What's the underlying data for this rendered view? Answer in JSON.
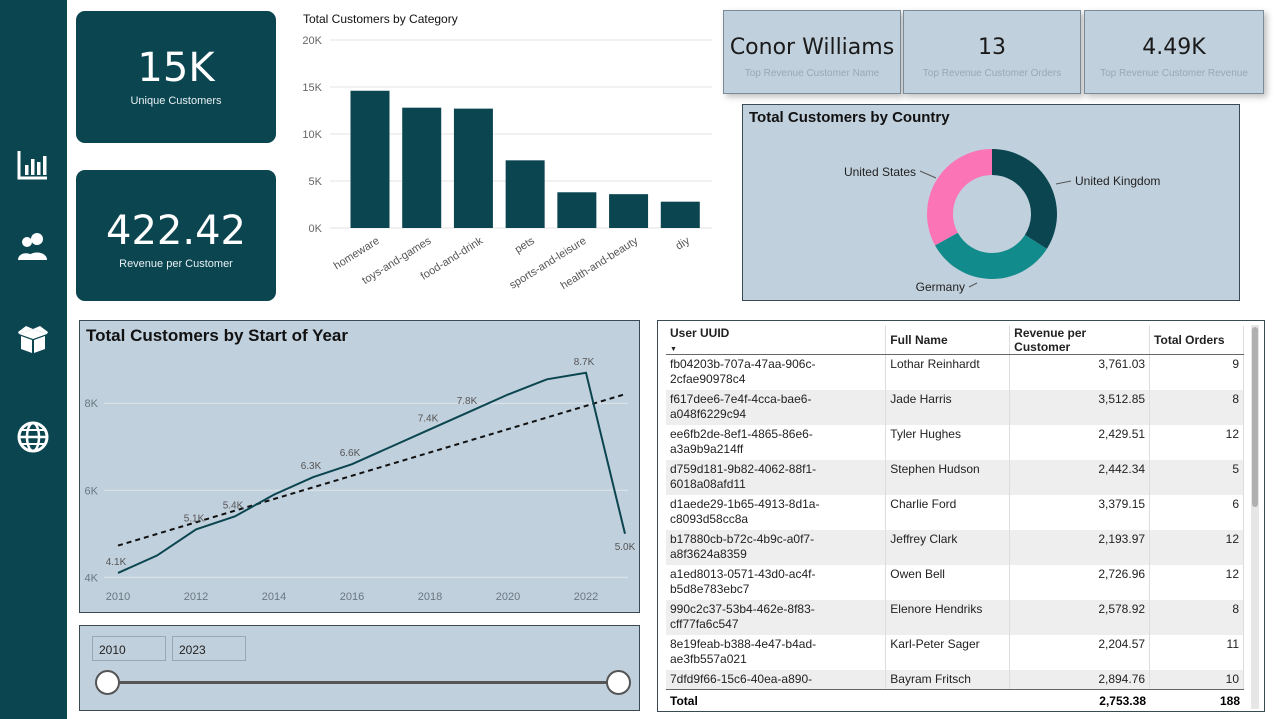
{
  "sidebar": {
    "icons": [
      "bar-chart-icon",
      "users-icon",
      "box-icon",
      "globe-icon"
    ]
  },
  "kpis": {
    "unique_customers": {
      "value": "15K",
      "label": "Unique Customers"
    },
    "revenue_per_customer": {
      "value": "422.42",
      "label": "Revenue per Customer"
    }
  },
  "top_cards": [
    {
      "value": "Conor Williams",
      "label": "Top Revenue Customer Name"
    },
    {
      "value": "13",
      "label": "Top Revenue Customer Orders"
    },
    {
      "value": "4.49K",
      "label": "Top Revenue Customer Revenue"
    }
  ],
  "colors": {
    "dark_teal": "#0a4550",
    "teal": "#118b8b",
    "pink": "#fb74b6",
    "panel": "#c1d0dd"
  },
  "chart_data": [
    {
      "type": "bar",
      "title": "Total Customers by Category",
      "categories": [
        "homeware",
        "toys-and-games",
        "food-and-drink",
        "pets",
        "sports-and-leisure",
        "health-and-beauty",
        "diy"
      ],
      "values": [
        14600,
        12800,
        12700,
        7200,
        3800,
        3600,
        2800
      ],
      "ylim": [
        0,
        20000
      ],
      "yticks": [
        "0K",
        "5K",
        "10K",
        "15K",
        "20K"
      ],
      "grid": true
    },
    {
      "type": "pie",
      "title": "Total Customers by Country",
      "labels": [
        "United Kingdom",
        "Germany",
        "United States"
      ],
      "values": [
        34,
        33,
        33
      ],
      "colors": [
        "#0a4550",
        "#118b8b",
        "#fb74b6"
      ]
    },
    {
      "type": "line",
      "title": "Total Customers by Start of Year",
      "x": [
        2010,
        2011,
        2012,
        2013,
        2014,
        2015,
        2016,
        2017,
        2018,
        2019,
        2020,
        2021,
        2022,
        2023
      ],
      "y": [
        4100,
        4500,
        5100,
        5400,
        5900,
        6300,
        6600,
        7000,
        7400,
        7800,
        8200,
        8550,
        8700,
        5000
      ],
      "data_labels": [
        "4.1K",
        "",
        "5.1K",
        "5.4K",
        "",
        "6.3K",
        "6.6K",
        "",
        "7.4K",
        "7.8K",
        "",
        "",
        "8.7K",
        "5.0K"
      ],
      "xticks": [
        "2010",
        "2012",
        "2014",
        "2016",
        "2018",
        "2020",
        "2022"
      ],
      "yticks": [
        "4K",
        "6K",
        "8K"
      ],
      "ylim": [
        3800,
        9200
      ],
      "trendline": true
    },
    {
      "type": "table",
      "columns": [
        "User UUID",
        "Full Name",
        "Revenue per Customer",
        "Total Orders"
      ],
      "rows": [
        [
          "fb04203b-707a-47aa-906c-2cfae90978c4",
          "Lothar Reinhardt",
          "3,761.03",
          "9"
        ],
        [
          "f617dee6-7e4f-4cca-bae6-a048f6229c94",
          "Jade Harris",
          "3,512.85",
          "8"
        ],
        [
          "ee6fb2de-8ef1-4865-86e6-a3a9b9a214ff",
          "Tyler Hughes",
          "2,429.51",
          "12"
        ],
        [
          "d759d181-9b82-4062-88f1-6018a08afd11",
          "Stephen Hudson",
          "2,442.34",
          "5"
        ],
        [
          "d1aede29-1b65-4913-8d1a-c8093d58cc8a",
          "Charlie Ford",
          "3,379.15",
          "6"
        ],
        [
          "b17880cb-b72c-4b9c-a0f7-a8f3624a8359",
          "Jeffrey Clark",
          "2,193.97",
          "12"
        ],
        [
          "a1ed8013-0571-43d0-ac4f-b5d8e783ebc7",
          "Owen Bell",
          "2,726.96",
          "12"
        ],
        [
          "990c2c37-53b4-462e-8f83-cff77fa6c547",
          "Elenore Hendriks",
          "2,578.92",
          "8"
        ],
        [
          "8e19feab-b388-4e47-b4ad-ae3fb557a021",
          "Karl-Peter Sager",
          "2,204.57",
          "11"
        ],
        [
          "7dfd9f66-15c6-40ea-a890-",
          "Bayram Fritsch",
          "2,894.76",
          "10"
        ]
      ],
      "total": {
        "label": "Total",
        "revenue": "2,753.38",
        "orders": "188"
      }
    }
  ],
  "slicer": {
    "from": "2010",
    "to": "2023"
  }
}
